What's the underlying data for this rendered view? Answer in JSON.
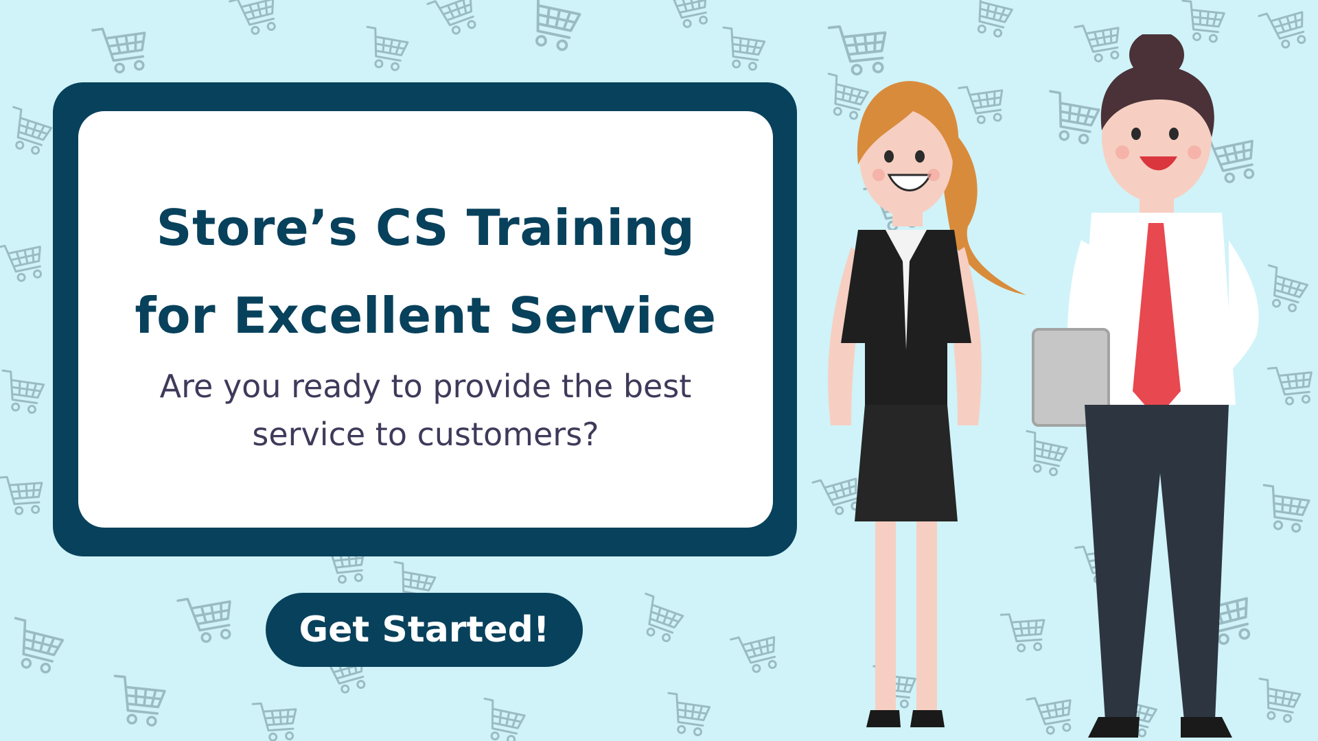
{
  "banner": {
    "title_line1": "Store’s CS Training",
    "title_line2": "for Excellent Service",
    "subtitle_line1": "Are you ready to provide the best",
    "subtitle_line2": "service to customers?",
    "cta_label": "Get Started!"
  },
  "colors": {
    "background": "#cff3f8",
    "card_border": "#08415c",
    "card_fill": "#ffffff",
    "title_text": "#08415c",
    "subtitle_text": "#3f3a5a",
    "cta_fill": "#08415c",
    "cta_text": "#ffffff",
    "pattern_icon": "#8aa9b3"
  },
  "icons": {
    "background_pattern": "shopping-cart-icon"
  }
}
